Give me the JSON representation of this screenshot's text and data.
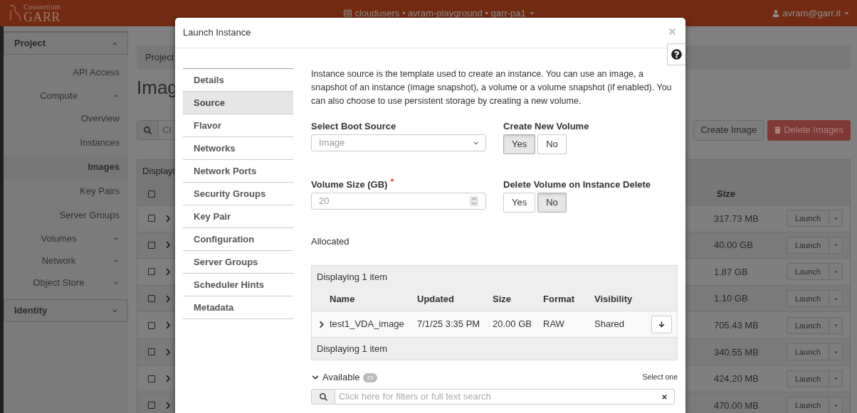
{
  "header": {
    "logo_small": "Consortium",
    "logo_large": "GARR",
    "project_selector": "cloudusers • avram-playground • garr-pa1",
    "user": "avram@garr.it"
  },
  "sidebar": {
    "items": [
      {
        "label": "Project",
        "kind": "section",
        "expanded": true,
        "children": [
          {
            "label": "API Access",
            "selected": false
          },
          {
            "label": "Compute",
            "kind": "group",
            "expanded": true,
            "children": [
              {
                "label": "Overview",
                "selected": false
              },
              {
                "label": "Instances",
                "selected": false
              },
              {
                "label": "Images",
                "selected": true
              },
              {
                "label": "Key Pairs",
                "selected": false
              },
              {
                "label": "Server Groups",
                "selected": false
              }
            ]
          },
          {
            "label": "Volumes",
            "kind": "group",
            "expanded": false
          },
          {
            "label": "Network",
            "kind": "group",
            "expanded": false
          },
          {
            "label": "Object Store",
            "kind": "group",
            "expanded": false
          }
        ]
      },
      {
        "label": "Identity",
        "kind": "section",
        "expanded": false
      }
    ]
  },
  "main": {
    "breadcrumb": "Project",
    "title": "Imag",
    "search_placeholder": "Cl",
    "buttons": [
      {
        "label": "Create Image",
        "kind": "default"
      },
      {
        "label": "Delete Images",
        "kind": "danger"
      }
    ],
    "table": {
      "caption": "Displayi",
      "all_checked": false,
      "columns": [
        "Size"
      ],
      "rows": [
        {
          "checked": false,
          "size": "317.73 MB",
          "action": "Launch"
        },
        {
          "checked": false,
          "size": "40.00 GB",
          "action": "Launch"
        },
        {
          "checked": false,
          "size": "1.87 GB",
          "action": "Launch"
        },
        {
          "checked": false,
          "size": "1.10 GB",
          "action": "Launch"
        },
        {
          "checked": false,
          "size": "705.43 MB",
          "action": "Launch"
        },
        {
          "checked": false,
          "size": "340.55 MB",
          "action": "Launch"
        },
        {
          "checked": false,
          "size": "424.20 MB",
          "action": "Launch"
        },
        {
          "checked": false,
          "size": "470.00 MB",
          "action": "Launch"
        }
      ]
    }
  },
  "modal": {
    "title": "Launch Instance",
    "steps": [
      {
        "label": "Details",
        "selected": false
      },
      {
        "label": "Source",
        "selected": true
      },
      {
        "label": "Flavor",
        "selected": false
      },
      {
        "label": "Networks",
        "selected": false
      },
      {
        "label": "Network Ports",
        "selected": false
      },
      {
        "label": "Security Groups",
        "selected": false
      },
      {
        "label": "Key Pair",
        "selected": false
      },
      {
        "label": "Configuration",
        "selected": false
      },
      {
        "label": "Server Groups",
        "selected": false
      },
      {
        "label": "Scheduler Hints",
        "selected": false
      },
      {
        "label": "Metadata",
        "selected": false
      }
    ],
    "description": "Instance source is the template used to create an instance. You can use an image, a snapshot of an instance (image snapshot), a volume or a volume snapshot (if enabled). You can also choose to use persistent storage by creating a new volume.",
    "boot_source": {
      "label": "Select Boot Source",
      "value": "Image"
    },
    "create_new_volume": {
      "label": "Create New Volume",
      "options": [
        {
          "label": "Yes",
          "selected": true
        },
        {
          "label": "No",
          "selected": false
        }
      ]
    },
    "volume_size": {
      "label": "Volume Size (GB)",
      "required_mark": "*",
      "value": "20"
    },
    "delete_volume": {
      "label": "Delete Volume on Instance Delete",
      "options": [
        {
          "label": "Yes",
          "selected": false
        },
        {
          "label": "No",
          "selected": true
        }
      ]
    },
    "allocated": {
      "title": "Allocated",
      "caption": "Displaying 1 item",
      "columns": [
        "Name",
        "Updated",
        "Size",
        "Format",
        "Visibility"
      ],
      "rows": [
        {
          "name": "test1_VDA_image",
          "updated": "7/1/25 3:35 PM",
          "size": "20.00 GB",
          "format": "RAW",
          "visibility": "Shared",
          "expanded": false
        }
      ],
      "footer": "Displaying 1 item"
    },
    "available": {
      "title": "Available",
      "count": "23",
      "expanded": true,
      "hint": "Select one",
      "search_placeholder": "Click here for filters or full text search"
    }
  }
}
